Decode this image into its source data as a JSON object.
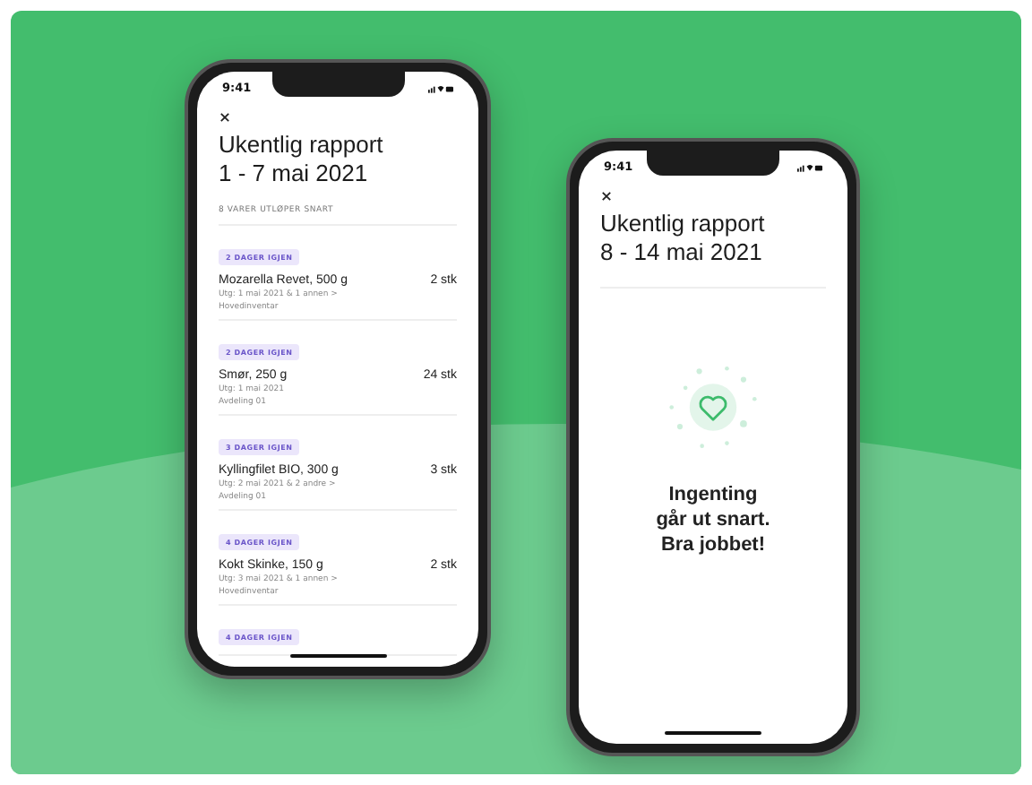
{
  "phones": [
    {
      "kind": "list",
      "status_time": "9:41",
      "title": "Ukentlig rapport",
      "period": "1 - 7 mai 2021",
      "section_label": "8 VARER UTLØPER SNART",
      "items": [
        {
          "badge": "2 DAGER IGJEN",
          "name": "Mozarella Revet, 500 g",
          "quantity": "2 stk",
          "expiry": "Utg: 1 mai 2021 & 1 annen >",
          "location": "Hovedinventar"
        },
        {
          "badge": "2 DAGER IGJEN",
          "name": "Smør, 250 g",
          "quantity": "24 stk",
          "expiry": "Utg: 1 mai 2021",
          "location": "Avdeling 01"
        },
        {
          "badge": "3 DAGER IGJEN",
          "name": "Kyllingfilet BIO, 300 g",
          "quantity": "3 stk",
          "expiry": "Utg: 2 mai 2021 & 2 andre >",
          "location": "Avdeling 01"
        },
        {
          "badge": "4 DAGER IGJEN",
          "name": "Kokt Skinke, 150 g",
          "quantity": "2 stk",
          "expiry": "Utg: 3 mai 2021 & 1 annen >",
          "location": "Hovedinventar"
        },
        {
          "badge": "4 DAGER IGJEN"
        }
      ]
    },
    {
      "kind": "empty",
      "status_time": "9:41",
      "title": "Ukentlig rapport",
      "period": "8 - 14  mai 2021",
      "message": "Ingenting\ngår ut snart.\nBra jobbet!"
    }
  ]
}
